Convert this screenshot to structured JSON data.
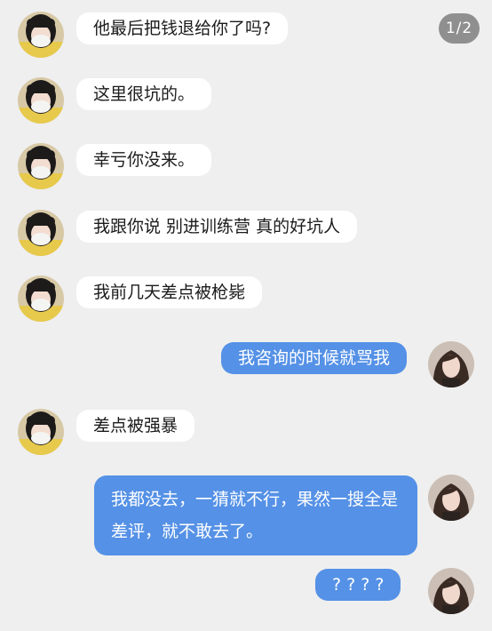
{
  "page_indicator": "1/2",
  "messages": [
    {
      "side": "in",
      "text": "他最后把钱退给你了吗?"
    },
    {
      "side": "in",
      "text": "这里很坑的。"
    },
    {
      "side": "in",
      "text": "幸亏你没来。"
    },
    {
      "side": "in",
      "text": "我跟你说 别进训练营 真的好坑人"
    },
    {
      "side": "in",
      "text": "我前几天差点被枪毙"
    },
    {
      "side": "out",
      "text": "我咨询的时候就骂我"
    },
    {
      "side": "in",
      "text": "差点被强暴"
    },
    {
      "side": "out",
      "text": "我都没去，一猜就不行，果然一搜全是差评，就不敢去了。"
    },
    {
      "side": "out",
      "text": "? ? ? ?"
    }
  ],
  "colors": {
    "background": "#efefef",
    "incoming_bubble": "#ffffff",
    "outgoing_bubble": "#5591e6",
    "page_indicator": "#8f8f8f"
  }
}
